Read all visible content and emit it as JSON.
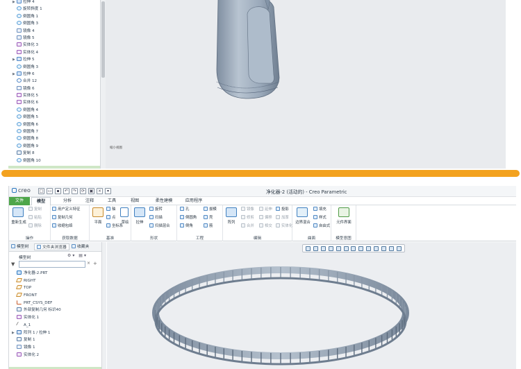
{
  "top_tree": [
    {
      "label": "拉伸 4",
      "icon": "extrude",
      "expand": true
    },
    {
      "label": "旋转斜度 1",
      "icon": "round"
    },
    {
      "label": "倒圆角 1",
      "icon": "round"
    },
    {
      "label": "倒圆角 3",
      "icon": "round"
    },
    {
      "label": "镜像 4",
      "icon": "mirror"
    },
    {
      "label": "镜像 5",
      "icon": "mirror"
    },
    {
      "label": "实体化 3",
      "icon": "solid"
    },
    {
      "label": "实体化 4",
      "icon": "solid"
    },
    {
      "label": "拉伸 5",
      "icon": "extrude",
      "expand": true
    },
    {
      "label": "倒圆角 3",
      "icon": "round"
    },
    {
      "label": "拉伸 6",
      "icon": "extrude",
      "expand": true
    },
    {
      "label": "合并 12",
      "icon": "merge"
    },
    {
      "label": "镜像 6",
      "icon": "mirror"
    },
    {
      "label": "实体化 5",
      "icon": "solid"
    },
    {
      "label": "实体化 6",
      "icon": "solid"
    },
    {
      "label": "倒圆角 4",
      "icon": "round"
    },
    {
      "label": "倒圆角 5",
      "icon": "round"
    },
    {
      "label": "倒圆角 6",
      "icon": "round"
    },
    {
      "label": "倒圆角 7",
      "icon": "round"
    },
    {
      "label": "倒圆角 8",
      "icon": "round"
    },
    {
      "label": "倒圆角 9",
      "icon": "round"
    },
    {
      "label": "复制 8",
      "icon": "copy"
    },
    {
      "label": "倒圆角 10",
      "icon": "round"
    }
  ],
  "top_viewport_label": "缩小视图",
  "app": {
    "logo": "creo",
    "window_title": "净化器-2 (活动的) - Creo Parametric"
  },
  "tabs": [
    "文件",
    "模型",
    "分析",
    "注释",
    "工具",
    "视图",
    "柔性建模",
    "应用程序"
  ],
  "ribbon": {
    "operations": {
      "label": "操作",
      "regen": "重新生成",
      "copy": "复制",
      "paste": "粘贴",
      "delete": "删除"
    },
    "get_data": {
      "label": "获取数据",
      "udf": "用户定义特征",
      "copy_geom": "复制几何",
      "shrinkwrap": "收缩包络"
    },
    "datum": {
      "label": "基准",
      "plane": "平面",
      "axis": "轴",
      "point": "点",
      "csys": "坐标系",
      "sketch": "草绘"
    },
    "shapes": {
      "label": "形状",
      "extrude": "拉伸",
      "revolve": "旋转",
      "sweep": "扫描",
      "swept_blend": "扫描混合"
    },
    "engineering": {
      "label": "工程",
      "hole": "孔",
      "round": "倒圆角",
      "chamfer": "倒角",
      "draft": "拔模",
      "shell": "壳",
      "rib": "筋"
    },
    "editing": {
      "label": "编辑",
      "pattern": "阵列",
      "mirror": "镜像",
      "extend": "延伸",
      "project": "投影",
      "trim": "修剪",
      "offset": "偏移",
      "thicken": "加厚",
      "merge": "合并",
      "intersect": "相交",
      "solidify": "实体化"
    },
    "surfaces": {
      "label": "曲面",
      "boundary": "边界混合",
      "fill": "填充",
      "style": "样式",
      "freestyle": "自由式"
    },
    "model_intent": {
      "label": "模型意图",
      "component_interface": "元件界面"
    }
  },
  "nav_tabs": [
    "模型树",
    "文件夹浏览器",
    "收藏夹"
  ],
  "tree_header": "模型树",
  "tree": [
    {
      "label": "净化器-2.PRT",
      "icon": "part"
    },
    {
      "label": "RIGHT",
      "icon": "plane"
    },
    {
      "label": "TOP",
      "icon": "plane"
    },
    {
      "label": "FRONT",
      "icon": "plane"
    },
    {
      "label": "PRT_CSYS_DEF",
      "icon": "csys"
    },
    {
      "label": "外部复制几何 标识40",
      "icon": "copy"
    },
    {
      "label": "实体化 1",
      "icon": "solid"
    },
    {
      "label": "A_1",
      "icon": "axis"
    },
    {
      "label": "阵列 1 / 拉伸 1",
      "icon": "pattern",
      "expand": true
    },
    {
      "label": "复制 1",
      "icon": "copy"
    },
    {
      "label": "镜像 1",
      "icon": "mirror"
    },
    {
      "label": "实体化 2",
      "icon": "solid"
    }
  ],
  "colors": {
    "accent_file_tab": "#4ea64a",
    "separator": "#f3a21f",
    "model_steel": "#9aa9ba"
  }
}
